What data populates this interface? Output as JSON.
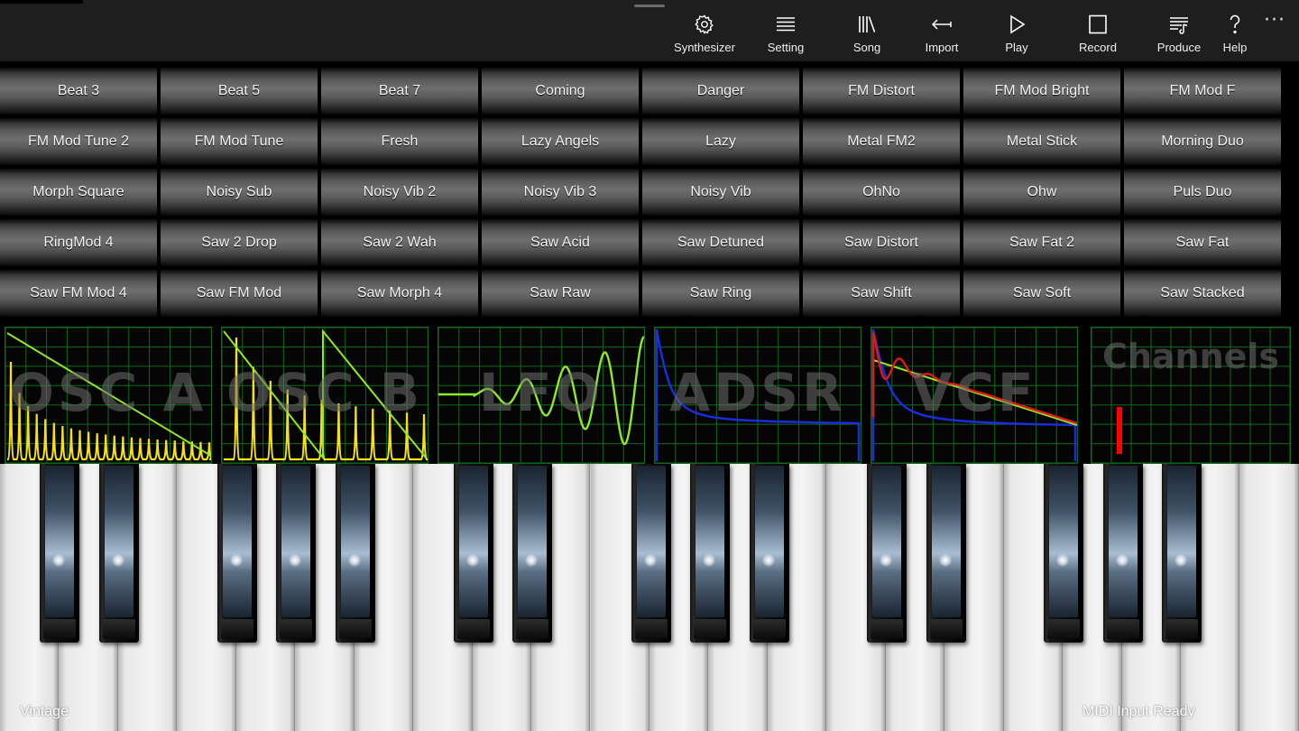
{
  "appbar": {
    "buttons": [
      {
        "label": "Synthesizer",
        "icon": "gear-icon"
      },
      {
        "label": "Setting",
        "icon": "list-icon"
      },
      {
        "label": "Song",
        "icon": "library-icon"
      },
      {
        "label": "Import",
        "icon": "import-arrow-icon"
      },
      {
        "label": "Play",
        "icon": "play-icon"
      },
      {
        "label": "Record",
        "icon": "stop-square-icon"
      },
      {
        "label": "Produce",
        "icon": "playlist-icon"
      },
      {
        "label": "Help",
        "icon": "question-icon"
      }
    ],
    "more": "···"
  },
  "presets": [
    "Beat 3",
    "Beat 5",
    "Beat 7",
    "Coming",
    "Danger",
    "FM Distort",
    "FM Mod Bright",
    "FM Mod F",
    "FM Mod Tune 2",
    "FM Mod Tune",
    "Fresh",
    "Lazy Angels",
    "Lazy",
    "Metal FM2",
    "Metal Stick",
    "Morning Duo",
    "Morph Square",
    "Noisy Sub",
    "Noisy Vib 2",
    "Noisy Vib 3",
    "Noisy Vib",
    "OhNo",
    "Ohw",
    "Puls Duo",
    "RingMod 4",
    "Saw 2 Drop",
    "Saw 2 Wah",
    "Saw Acid",
    "Saw Detuned",
    "Saw Distort",
    "Saw Fat 2",
    "Saw Fat",
    "Saw FM Mod 4",
    "Saw FM Mod",
    "Saw Morph 4",
    "Saw Raw",
    "Saw Ring",
    "Saw Shift",
    "Saw Soft",
    "Saw Stacked"
  ],
  "panels": {
    "osc_a": "OSC A",
    "osc_b": "OSC B",
    "lfo": "LFO",
    "adsr": "ADSR",
    "vcf": "VCF",
    "channels": "Channels"
  },
  "colors": {
    "grid": "#0f6a1a",
    "spectrum": "#f5e11a",
    "wave": "#8fe82a",
    "envelope": "#1a2ee0",
    "filter": "#e01818",
    "meter": "#ff0000"
  },
  "status": {
    "left": "Vintage",
    "right": "MIDI Input Ready"
  }
}
